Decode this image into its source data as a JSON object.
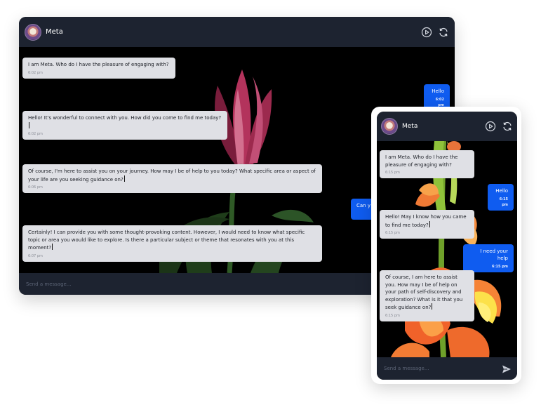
{
  "bot_name": "Meta",
  "desktop": {
    "messages": [
      {
        "text": "I am Meta. Who do I have the pleasure of engaging with?",
        "time": "6:02 pm"
      },
      {
        "text": "Hello",
        "time": "6:02 pm"
      },
      {
        "text": "Hello! It's wonderful to connect with you. How did you come to find me today?",
        "time": "6:02 pm"
      },
      {
        "text": "Of course, I'm here to assist you on your journey. How may I be of help to you today? What specific area or aspect of your life are you seeking guidance on?",
        "time": "6:06 pm"
      },
      {
        "text": "Can y",
        "time": ""
      },
      {
        "text": "Certainly! I can provide you with some thought-provoking content. However, I would need to know what specific topic or area you would like to explore. Is there a particular subject or theme that resonates with you at this moment?",
        "time": "6:07 pm"
      }
    ],
    "placeholder": "Send a message..."
  },
  "mobile": {
    "messages": [
      {
        "text": "I am Meta. Who do I have the pleasure of engaging with?",
        "time": "6:15 pm"
      },
      {
        "text": "Hello",
        "time": "6:15 pm"
      },
      {
        "text": "Hello! May I know how you came to find me today?",
        "time": "6:15 pm"
      },
      {
        "text": "I need your help",
        "time": "6:15 pm"
      },
      {
        "text": "Of course, I am here to assist you. How may I be of help on your path of self-discovery and exploration? What is it that you seek guidance on?",
        "time": "6:15 pm"
      }
    ],
    "placeholder": "Send a message..."
  },
  "icons": {
    "play": "play-circle-icon",
    "refresh": "refresh-icon",
    "send": "send-icon"
  },
  "colors": {
    "header_bg": "#1d2330",
    "user_bubble": "#0f5cf0",
    "bot_bubble": "#dfe0e5",
    "chat_bg": "#000000"
  }
}
